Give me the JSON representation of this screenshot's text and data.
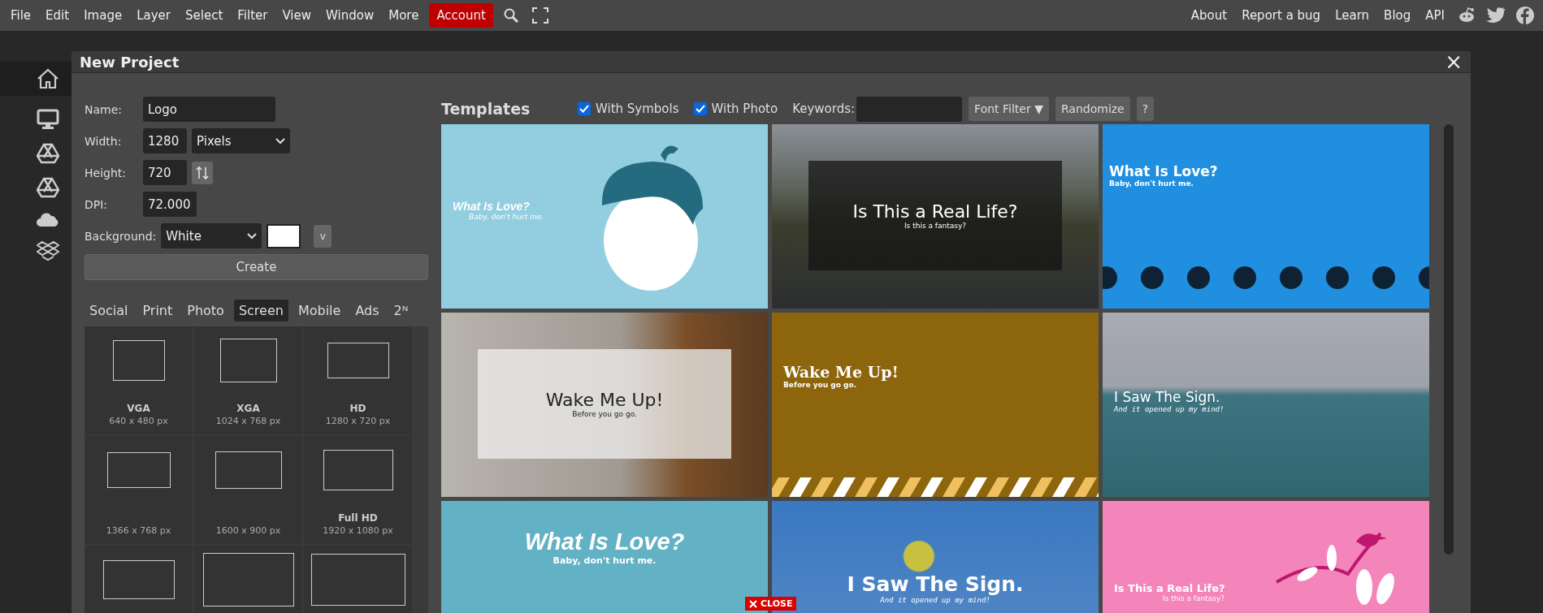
{
  "menu": {
    "items": [
      "File",
      "Edit",
      "Image",
      "Layer",
      "Select",
      "Filter",
      "View",
      "Window",
      "More"
    ],
    "account": "Account",
    "links": [
      "About",
      "Report a bug",
      "Learn",
      "Blog",
      "API"
    ]
  },
  "dialog": {
    "title": "New Project",
    "close": "×"
  },
  "form": {
    "name_label": "Name:",
    "name_value": "Logo",
    "width_label": "Width:",
    "width_value": "1280",
    "unit": "Pixels",
    "height_label": "Height:",
    "height_value": "720",
    "dpi_label": "DPI:",
    "dpi_value": "72.000",
    "background_label": "Background:",
    "background_value": "White",
    "color_menu": "v",
    "create": "Create"
  },
  "preset_tabs": [
    {
      "label": "Social",
      "selected": false
    },
    {
      "label": "Print",
      "selected": false
    },
    {
      "label": "Photo",
      "selected": false
    },
    {
      "label": "Screen",
      "selected": true
    },
    {
      "label": "Mobile",
      "selected": false
    },
    {
      "label": "Ads",
      "selected": false
    },
    {
      "label": "2ᴺ",
      "selected": false
    }
  ],
  "presets": [
    {
      "kind": "sized",
      "name": "VGA",
      "size": "640 x 480 px"
    },
    {
      "kind": "sized",
      "name": "XGA",
      "size": "1024 x 768 px"
    },
    {
      "kind": "sized",
      "name": "HD",
      "size": "1280 x 720 px"
    },
    {
      "kind": "sized",
      "size": "1366 x 768 px"
    },
    {
      "kind": "sized",
      "size": "1600 x 900 px"
    },
    {
      "kind": "sized",
      "name": "Full HD",
      "size": "1920 x 1080 px"
    },
    {
      "kind": "blank"
    },
    {
      "kind": "blank"
    },
    {
      "kind": "blank"
    }
  ],
  "templates": {
    "title": "Templates",
    "with_symbols": {
      "label": "With Symbols",
      "checked": true
    },
    "with_photo": {
      "label": "With Photo",
      "checked": true
    },
    "keywords_label": "Keywords:",
    "font_filter": "Font Filter ▼",
    "randomize": "Randomize",
    "help": "?",
    "items": [
      {
        "kind": "acorn",
        "title": "What Is Love?",
        "subtitle": "Baby, don't hurt me."
      },
      {
        "kind": "road",
        "title": "Is This a Real Life?",
        "subtitle": "Is this a fantasy?"
      },
      {
        "kind": "dots",
        "title": "What Is Love?",
        "subtitle": "Baby, don't hurt me."
      },
      {
        "kind": "lantern",
        "title": "Wake Me Up!",
        "subtitle": "Before you go go."
      },
      {
        "kind": "stripes",
        "title": "Wake Me Up!",
        "subtitle": "Before you go go."
      },
      {
        "kind": "sea",
        "title": "I Saw The Sign.",
        "subtitle": "And it opened up my mind!"
      },
      {
        "kind": "love",
        "title": "What Is Love?",
        "subtitle": "Baby, don't hurt me."
      },
      {
        "kind": "bird",
        "title": "I Saw The Sign.",
        "subtitle": "And it opened up my mind!"
      },
      {
        "kind": "pink",
        "title": "Is This a Real Life?",
        "subtitle": "Is this a fantasy?"
      }
    ]
  },
  "ad_close": "CLOSE"
}
